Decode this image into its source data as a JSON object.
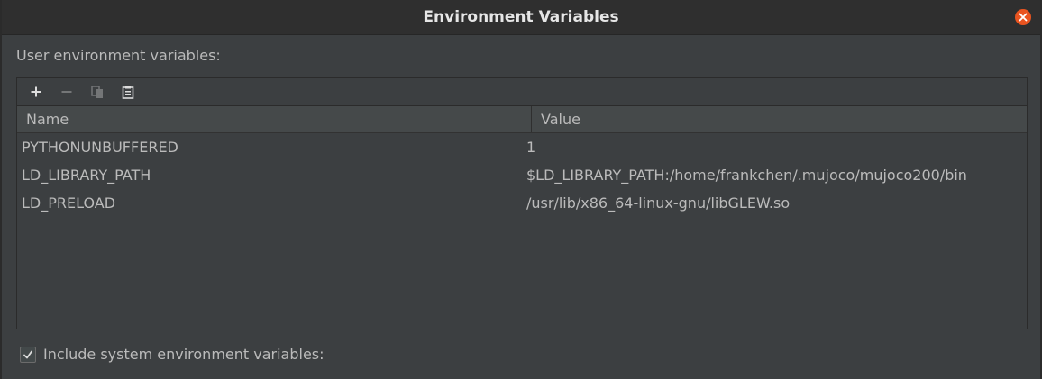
{
  "dialog": {
    "title": "Environment Variables",
    "close_icon": "close-icon",
    "accent": "#e95420"
  },
  "section": {
    "label": "User environment variables:"
  },
  "toolbar": {
    "buttons": [
      {
        "icon": "plus-icon",
        "enabled": true
      },
      {
        "icon": "minus-icon",
        "enabled": false
      },
      {
        "icon": "copy-icon",
        "enabled": false
      },
      {
        "icon": "paste-icon",
        "enabled": true
      }
    ]
  },
  "table": {
    "columns": [
      "Name",
      "Value"
    ],
    "rows": [
      {
        "name": "PYTHONUNBUFFERED",
        "value": "1"
      },
      {
        "name": "LD_LIBRARY_PATH",
        "value": "$LD_LIBRARY_PATH:/home/frankchen/.mujoco/mujoco200/bin"
      },
      {
        "name": "LD_PRELOAD",
        "value": "/usr/lib/x86_64-linux-gnu/libGLEW.so"
      }
    ]
  },
  "footer": {
    "checkbox_checked": true,
    "checkbox_label": "Include system environment variables:"
  }
}
